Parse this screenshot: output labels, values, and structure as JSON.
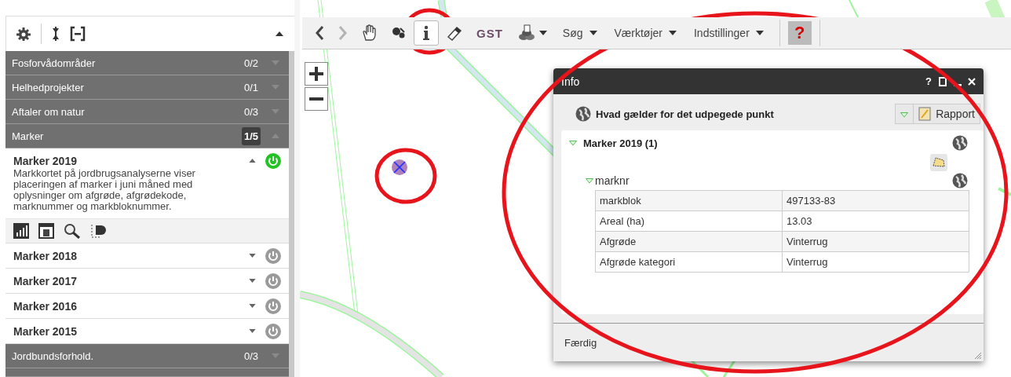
{
  "sidebar": {
    "groups": [
      {
        "label": "Fosforvådområder",
        "count": "0/2",
        "expanded": false
      },
      {
        "label": "Helhedprojekter",
        "count": "0/1",
        "expanded": false
      },
      {
        "label": "Aftaler om natur",
        "count": "0/3",
        "expanded": false
      },
      {
        "label": "Marker",
        "count": "1/5",
        "expanded": true,
        "layers": [
          {
            "title": "Marker 2019",
            "expanded": true,
            "on": true,
            "description": "Markkortet på jordbrugsanalyserne viser placeringen af marker i juni måned med oplysninger om afgrøde, afgrødekode, marknummer og markbloknummer."
          },
          {
            "title": "Marker 2018",
            "expanded": false,
            "on": false
          },
          {
            "title": "Marker 2017",
            "expanded": false,
            "on": false
          },
          {
            "title": "Marker 2016",
            "expanded": false,
            "on": false
          },
          {
            "title": "Marker 2015",
            "expanded": false,
            "on": false
          }
        ]
      },
      {
        "label": "Jordbundsforhold.",
        "count": "0/3",
        "expanded": false
      }
    ]
  },
  "toolbar": {
    "tools": [
      {
        "kind": "back",
        "selected": false,
        "disabled": false
      },
      {
        "kind": "forward",
        "selected": false,
        "disabled": true
      },
      {
        "kind": "pan",
        "selected": false,
        "disabled": false
      },
      {
        "kind": "select",
        "selected": false,
        "disabled": false
      },
      {
        "kind": "info",
        "selected": true,
        "disabled": false
      },
      {
        "kind": "eraser",
        "selected": false,
        "disabled": false
      },
      {
        "kind": "logo",
        "label": "GST",
        "selected": false,
        "disabled": false
      },
      {
        "kind": "layers",
        "selected": false,
        "disabled": false
      }
    ],
    "menus": [
      "Søg",
      "Værktøjer",
      "Indstillinger"
    ],
    "help": "?"
  },
  "info": {
    "title": "Info",
    "help": "?",
    "query_title": "Hvad gælder for det udpegede punkt",
    "report_button": "Rapport",
    "layers": [
      {
        "title": "Marker 2019 (1)",
        "expanded": true,
        "features": [
          {
            "title": "marknr",
            "expanded": true,
            "rows": [
              [
                "markblok",
                "497133-83"
              ],
              [
                "Areal (ha)",
                "13.03"
              ],
              [
                "Afgrøde",
                "Vinterrug"
              ],
              [
                "Afgrøde kategori",
                "Vinterrug"
              ]
            ]
          }
        ]
      }
    ],
    "status": "Færdig"
  }
}
